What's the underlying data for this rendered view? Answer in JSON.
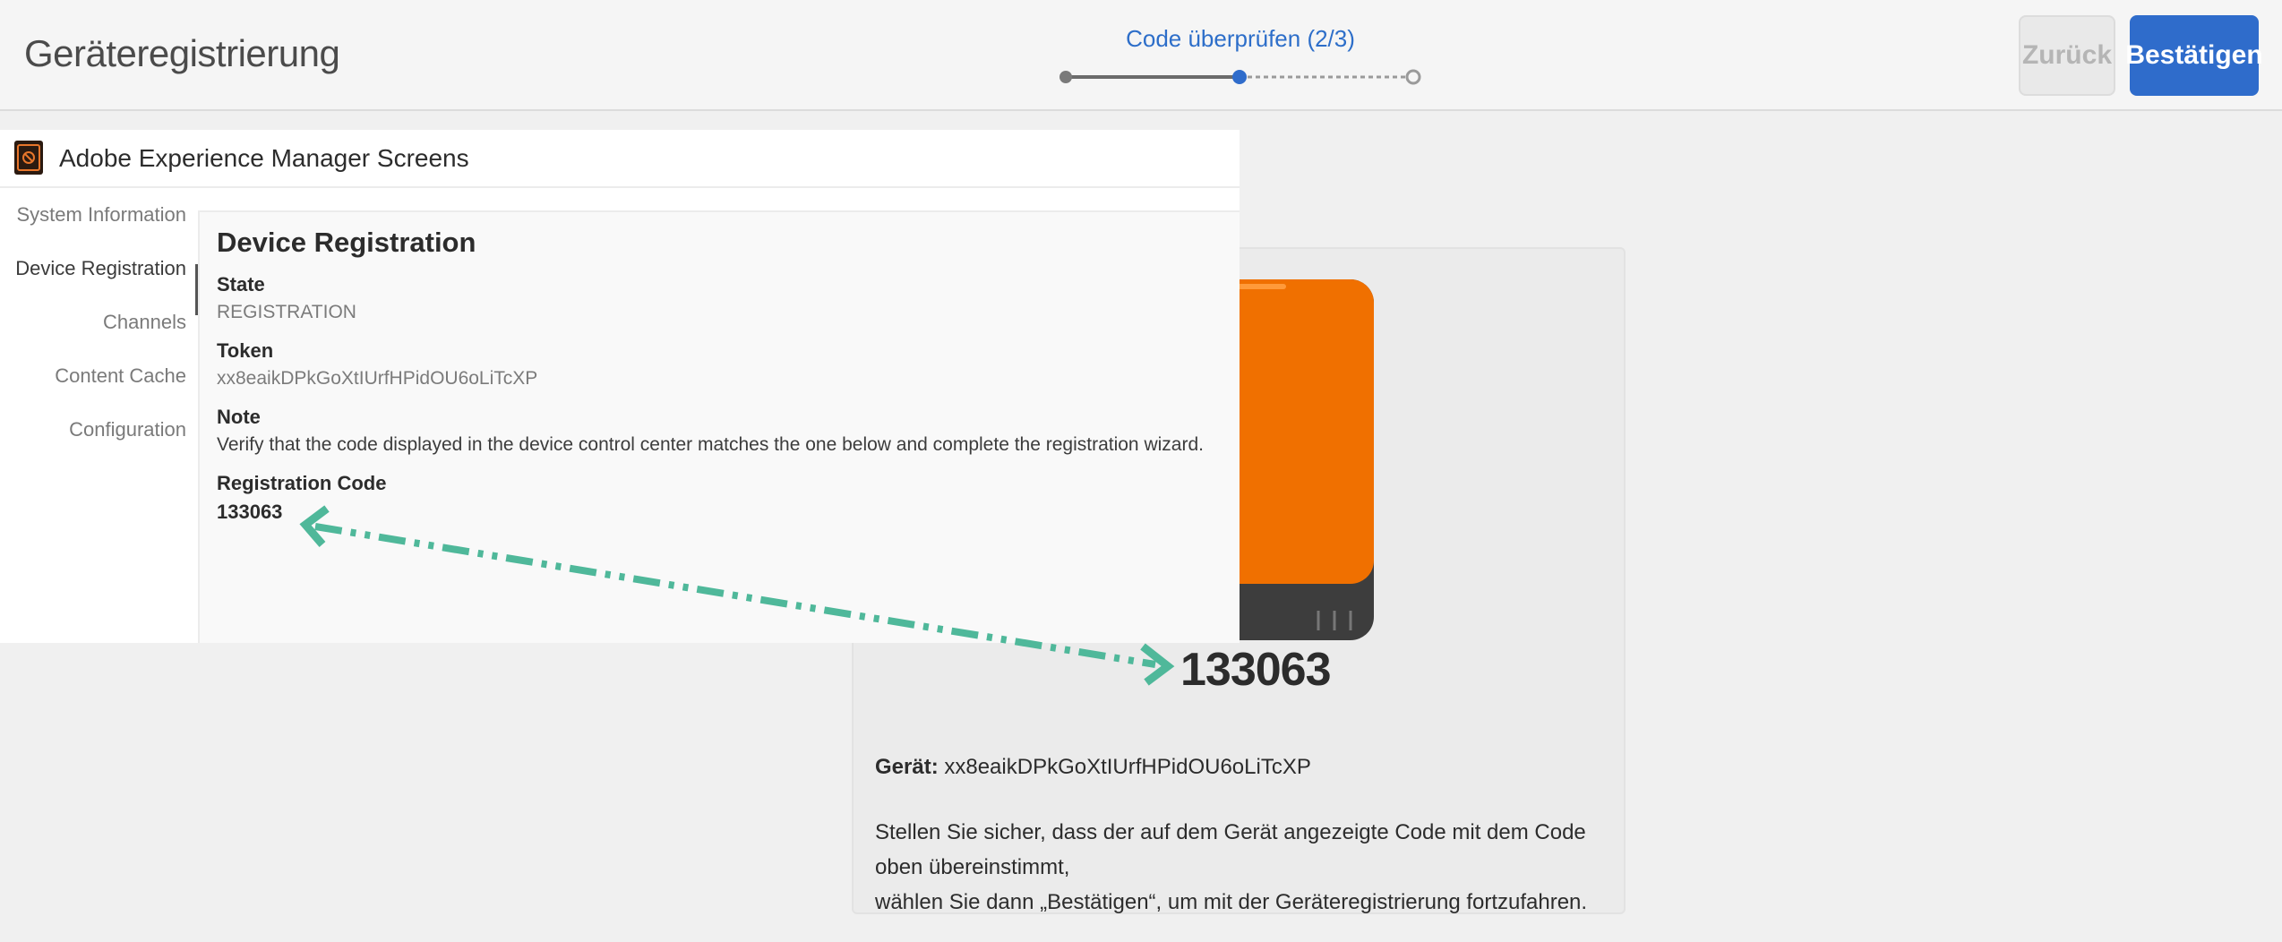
{
  "header": {
    "title": "Geräteregistrierung",
    "step_label": "Code überprüfen (2/3)",
    "back_label": "Zurück",
    "confirm_label": "Bestätigen"
  },
  "device_card": {
    "code": "133063",
    "device_label": "Gerät:",
    "device_token": "xx8eaikDPkGoXtIUrfHPidOU6oLiTcXP",
    "instruction_line1": "Stellen Sie sicher, dass der auf dem Gerät angezeigte Code mit dem Code oben übereinstimmt,",
    "instruction_line2": "wählen Sie dann „Bestätigen“, um mit der Geräteregistrierung fortzufahren."
  },
  "aem": {
    "app_title": "Adobe Experience Manager Screens",
    "nav": [
      "System Information",
      "Device Registration",
      "Channels",
      "Content Cache",
      "Configuration"
    ],
    "active_nav": "Device Registration",
    "content": {
      "title": "Device Registration",
      "state_label": "State",
      "state_value": "REGISTRATION",
      "token_label": "Token",
      "token_value": "xx8eaikDPkGoXtIUrfHPidOU6oLiTcXP",
      "note_label": "Note",
      "note_value": "Verify that the code displayed in the device control center matches the one below and complete the registration wizard.",
      "code_label": "Registration Code",
      "code_value": "133063"
    }
  },
  "colors": {
    "accent": "#2f6ccb",
    "device_orange": "#f07000",
    "arrow_teal": "#4fb89a"
  },
  "icons": [
    "aem-logo-icon",
    "double-arrow-icon"
  ]
}
